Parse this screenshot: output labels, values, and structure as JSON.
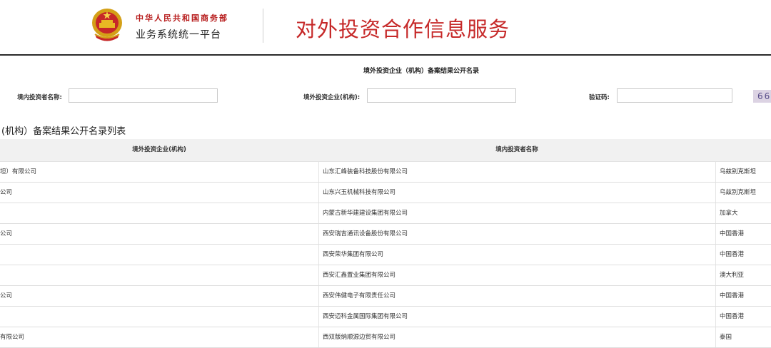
{
  "header": {
    "ministry": "中华人民共和国商务部",
    "platform": "业务系统统一平台",
    "service_title": "对外投资合作信息服务"
  },
  "search": {
    "form_title": "境外投资企业（机构）备案结果公开名录",
    "investor_label": "境内投资者名称:",
    "enterprise_label": "境外投资企业(机构):",
    "captcha_label": "验证码:",
    "captcha_value": "66"
  },
  "list": {
    "title": "(机构）备案结果公开名录列表",
    "columns": [
      "境外投资企业(机构)",
      "境内投资者名称",
      ""
    ],
    "rows": [
      {
        "enterprise": "坦）有限公司",
        "investor": "山东汇峰装备科技股份有限公司",
        "region": "乌兹别克斯坦"
      },
      {
        "enterprise": "公司",
        "investor": "山东兴玉机械科技有限公司",
        "region": "乌兹别克斯坦"
      },
      {
        "enterprise": "",
        "investor": "内蒙古新华建建设集团有限公司",
        "region": "加拿大"
      },
      {
        "enterprise": "公司",
        "investor": "西安瑞吉通讯设备股份有限公司",
        "region": "中国香港"
      },
      {
        "enterprise": "",
        "investor": "西安荣华集团有限公司",
        "region": "中国香港"
      },
      {
        "enterprise": "",
        "investor": "西安汇鑫置业集团有限公司",
        "region": "澳大利亚"
      },
      {
        "enterprise": "公司",
        "investor": "西安伟健电子有限责任公司",
        "region": "中国香港"
      },
      {
        "enterprise": "",
        "investor": "西安迈科金属国际集团有限公司",
        "region": "中国香港"
      },
      {
        "enterprise": "有限公司",
        "investor": "西双版纳顺源边贸有限公司",
        "region": "泰国"
      }
    ]
  },
  "colors": {
    "accent_red": "#c62828",
    "header_rule": "#2b2b2b",
    "table_header_bg": "#f1f1f1"
  }
}
